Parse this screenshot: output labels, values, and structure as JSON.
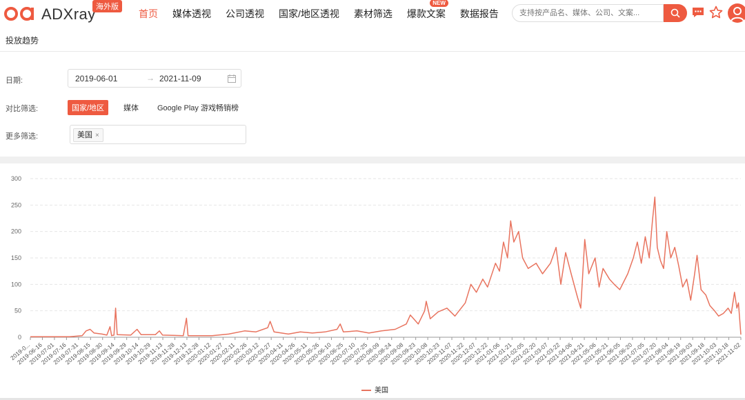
{
  "header": {
    "logo_text": "ADXray",
    "logo_badge": "海外版",
    "nav": [
      {
        "label": "首页",
        "active": true
      },
      {
        "label": "媒体透视"
      },
      {
        "label": "公司透视"
      },
      {
        "label": "国家/地区透视"
      },
      {
        "label": "素材筛选"
      },
      {
        "label": "爆款文案",
        "badge": "NEW"
      },
      {
        "label": "数据报告"
      }
    ],
    "search_placeholder": "支持按产品名、媒体、公司、文案..."
  },
  "section_title": "投放趋势",
  "filters": {
    "date_label": "日期:",
    "date_start": "2019-06-01",
    "date_arrow": "→",
    "date_end": "2021-11-09",
    "compare_label": "对比筛选:",
    "compare_options": [
      "国家/地区",
      "媒体",
      "Google Play 游戏畅销榜"
    ],
    "more_label": "更多筛选:",
    "tag": "美国",
    "tag_close": "×"
  },
  "colors": {
    "accent": "#ee5a40",
    "line": "#e8735e"
  },
  "chart_data": {
    "type": "line",
    "ylim": [
      0,
      300
    ],
    "yticks": [
      0,
      50,
      100,
      150,
      200,
      250,
      300
    ],
    "x_start": "2019-06-01",
    "x_end": "2021-11-09",
    "xticks": [
      "2019-0...",
      "2019-06-16",
      "2019-07-01",
      "2019-07-16",
      "2019-07-31",
      "2019-08-15",
      "2019-08-30",
      "2019-09-14",
      "2019-09-29",
      "2019-10-14",
      "2019-10-29",
      "2019-11-13",
      "2019-11-28",
      "2019-12-13",
      "2019-12-28",
      "2020-01-12",
      "2020-01-27",
      "2020-02-11",
      "2020-02-26",
      "2020-03-12",
      "2020-03-27",
      "2020-04-11",
      "2020-04-26",
      "2020-05-11",
      "2020-05-26",
      "2020-06-10",
      "2020-06-25",
      "2020-07-10",
      "2020-07-25",
      "2020-08-09",
      "2020-08-24",
      "2020-09-08",
      "2020-09-23",
      "2020-10-08",
      "2020-10-23",
      "2020-11-07",
      "2020-11-22",
      "2020-12-07",
      "2020-12-22",
      "2021-01-06",
      "2021-01-21",
      "2021-02-05",
      "2021-02-20",
      "2021-03-07",
      "2021-03-22",
      "2021-04-06",
      "2021-04-21",
      "2021-05-06",
      "2021-05-21",
      "2021-06-05",
      "2021-06-20",
      "2021-07-05",
      "2021-07-20",
      "2021-08-04",
      "2021-08-19",
      "2021-09-03",
      "2021-09-18",
      "2021-10-03",
      "2021-10-18",
      "2021-11-02"
    ],
    "series": [
      {
        "name": "美国",
        "points": [
          [
            "2019-06-01",
            1
          ],
          [
            "2019-07-20",
            1
          ],
          [
            "2019-08-05",
            3
          ],
          [
            "2019-08-10",
            12
          ],
          [
            "2019-08-15",
            15
          ],
          [
            "2019-08-20",
            8
          ],
          [
            "2019-08-30",
            6
          ],
          [
            "2019-09-05",
            4
          ],
          [
            "2019-09-09",
            20
          ],
          [
            "2019-09-11",
            3
          ],
          [
            "2019-09-14",
            4
          ],
          [
            "2019-09-16",
            55
          ],
          [
            "2019-09-18",
            5
          ],
          [
            "2019-10-05",
            4
          ],
          [
            "2019-10-13",
            15
          ],
          [
            "2019-10-18",
            5
          ],
          [
            "2019-11-05",
            5
          ],
          [
            "2019-11-10",
            12
          ],
          [
            "2019-11-14",
            4
          ],
          [
            "2019-12-10",
            3
          ],
          [
            "2019-12-14",
            36
          ],
          [
            "2019-12-16",
            3
          ],
          [
            "2020-01-15",
            3
          ],
          [
            "2020-02-05",
            6
          ],
          [
            "2020-02-25",
            12
          ],
          [
            "2020-03-10",
            10
          ],
          [
            "2020-03-25",
            18
          ],
          [
            "2020-03-28",
            30
          ],
          [
            "2020-04-02",
            10
          ],
          [
            "2020-04-20",
            6
          ],
          [
            "2020-05-05",
            10
          ],
          [
            "2020-05-20",
            8
          ],
          [
            "2020-06-05",
            10
          ],
          [
            "2020-06-20",
            15
          ],
          [
            "2020-06-24",
            25
          ],
          [
            "2020-06-28",
            10
          ],
          [
            "2020-07-15",
            12
          ],
          [
            "2020-07-30",
            8
          ],
          [
            "2020-08-15",
            12
          ],
          [
            "2020-09-01",
            15
          ],
          [
            "2020-09-15",
            25
          ],
          [
            "2020-09-20",
            42
          ],
          [
            "2020-09-30",
            25
          ],
          [
            "2020-10-08",
            50
          ],
          [
            "2020-10-10",
            68
          ],
          [
            "2020-10-15",
            35
          ],
          [
            "2020-10-25",
            48
          ],
          [
            "2020-11-05",
            55
          ],
          [
            "2020-11-15",
            40
          ],
          [
            "2020-11-28",
            65
          ],
          [
            "2020-12-05",
            100
          ],
          [
            "2020-12-12",
            85
          ],
          [
            "2020-12-20",
            110
          ],
          [
            "2020-12-26",
            95
          ],
          [
            "2021-01-05",
            140
          ],
          [
            "2021-01-10",
            125
          ],
          [
            "2021-01-15",
            180
          ],
          [
            "2021-01-20",
            150
          ],
          [
            "2021-01-24",
            220
          ],
          [
            "2021-01-28",
            180
          ],
          [
            "2021-02-03",
            200
          ],
          [
            "2021-02-08",
            150
          ],
          [
            "2021-02-15",
            130
          ],
          [
            "2021-02-25",
            140
          ],
          [
            "2021-03-05",
            120
          ],
          [
            "2021-03-15",
            140
          ],
          [
            "2021-03-22",
            170
          ],
          [
            "2021-03-28",
            100
          ],
          [
            "2021-04-03",
            160
          ],
          [
            "2021-04-10",
            120
          ],
          [
            "2021-04-18",
            75
          ],
          [
            "2021-04-22",
            55
          ],
          [
            "2021-04-27",
            185
          ],
          [
            "2021-05-02",
            120
          ],
          [
            "2021-05-10",
            150
          ],
          [
            "2021-05-15",
            95
          ],
          [
            "2021-05-20",
            130
          ],
          [
            "2021-05-28",
            110
          ],
          [
            "2021-06-03",
            100
          ],
          [
            "2021-06-10",
            90
          ],
          [
            "2021-06-20",
            120
          ],
          [
            "2021-06-27",
            150
          ],
          [
            "2021-07-02",
            180
          ],
          [
            "2021-07-07",
            140
          ],
          [
            "2021-07-12",
            190
          ],
          [
            "2021-07-17",
            150
          ],
          [
            "2021-07-21",
            220
          ],
          [
            "2021-07-24",
            265
          ],
          [
            "2021-07-27",
            170
          ],
          [
            "2021-07-31",
            145
          ],
          [
            "2021-08-04",
            130
          ],
          [
            "2021-08-08",
            200
          ],
          [
            "2021-08-13",
            150
          ],
          [
            "2021-08-18",
            170
          ],
          [
            "2021-08-23",
            135
          ],
          [
            "2021-08-28",
            95
          ],
          [
            "2021-09-02",
            110
          ],
          [
            "2021-09-07",
            70
          ],
          [
            "2021-09-12",
            120
          ],
          [
            "2021-09-15",
            155
          ],
          [
            "2021-09-20",
            90
          ],
          [
            "2021-09-26",
            80
          ],
          [
            "2021-10-01",
            60
          ],
          [
            "2021-10-07",
            50
          ],
          [
            "2021-10-12",
            40
          ],
          [
            "2021-10-18",
            45
          ],
          [
            "2021-10-24",
            55
          ],
          [
            "2021-10-28",
            45
          ],
          [
            "2021-11-01",
            85
          ],
          [
            "2021-11-04",
            55
          ],
          [
            "2021-11-06",
            65
          ],
          [
            "2021-11-09",
            5
          ]
        ]
      }
    ],
    "legend": "美国",
    "legend_position": "bottom-center",
    "grid": true
  }
}
